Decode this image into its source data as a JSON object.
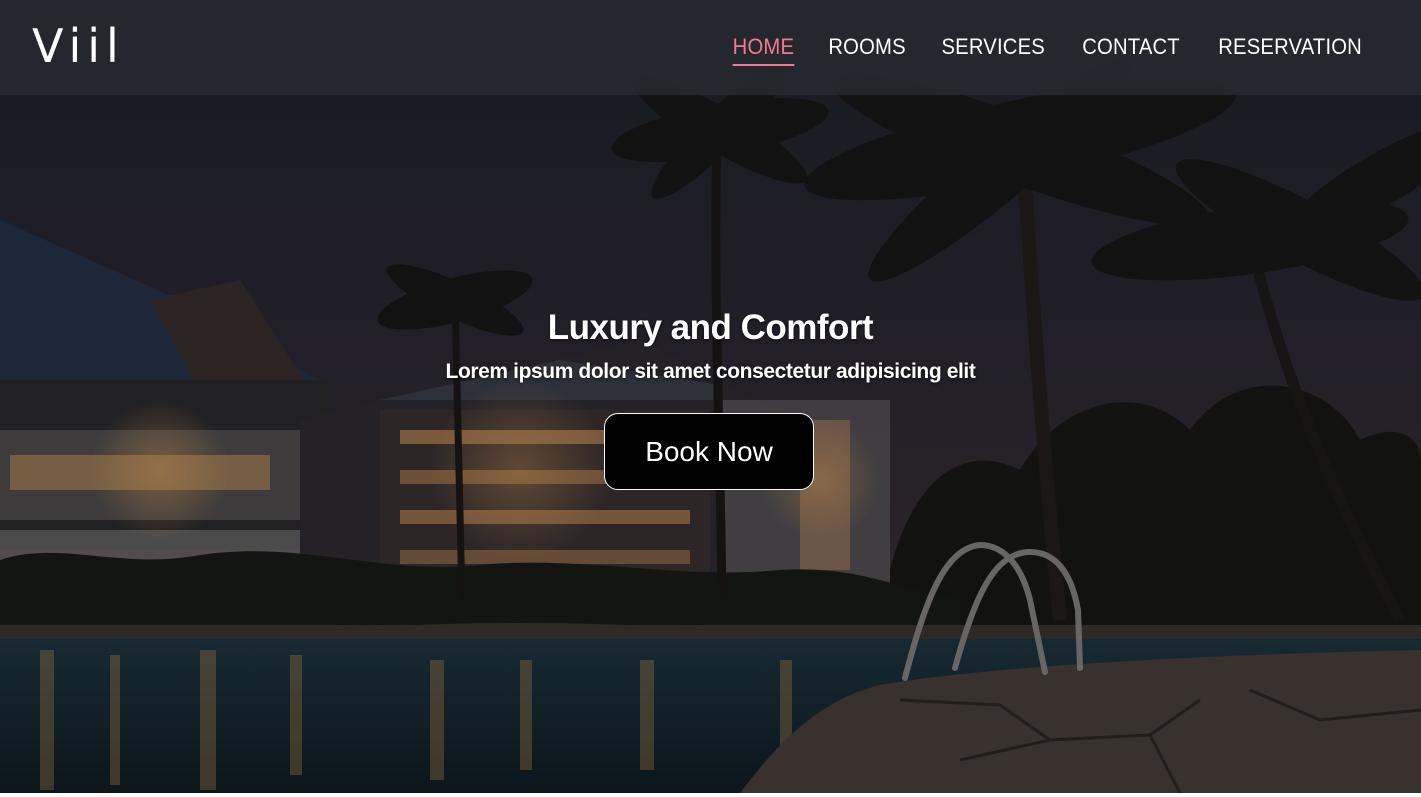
{
  "brand": {
    "logo_text": "Viil"
  },
  "nav": {
    "items": [
      {
        "label": "HOME",
        "active": true
      },
      {
        "label": "ROOMS",
        "active": false
      },
      {
        "label": "SERVICES",
        "active": false
      },
      {
        "label": "CONTACT",
        "active": false
      },
      {
        "label": "RESERVATION",
        "active": false
      }
    ],
    "active_color": "#f07a93"
  },
  "hero": {
    "title": "Luxury and Comfort",
    "subtitle": "Lorem ipsum dolor sit amet consectetur adipisicing elit",
    "cta_label": "Book Now",
    "background_subject": "night-resort-pool-with-palm-trees"
  },
  "colors": {
    "navbar_bg": "#262930",
    "cta_bg": "#000000",
    "text": "#ffffff"
  }
}
